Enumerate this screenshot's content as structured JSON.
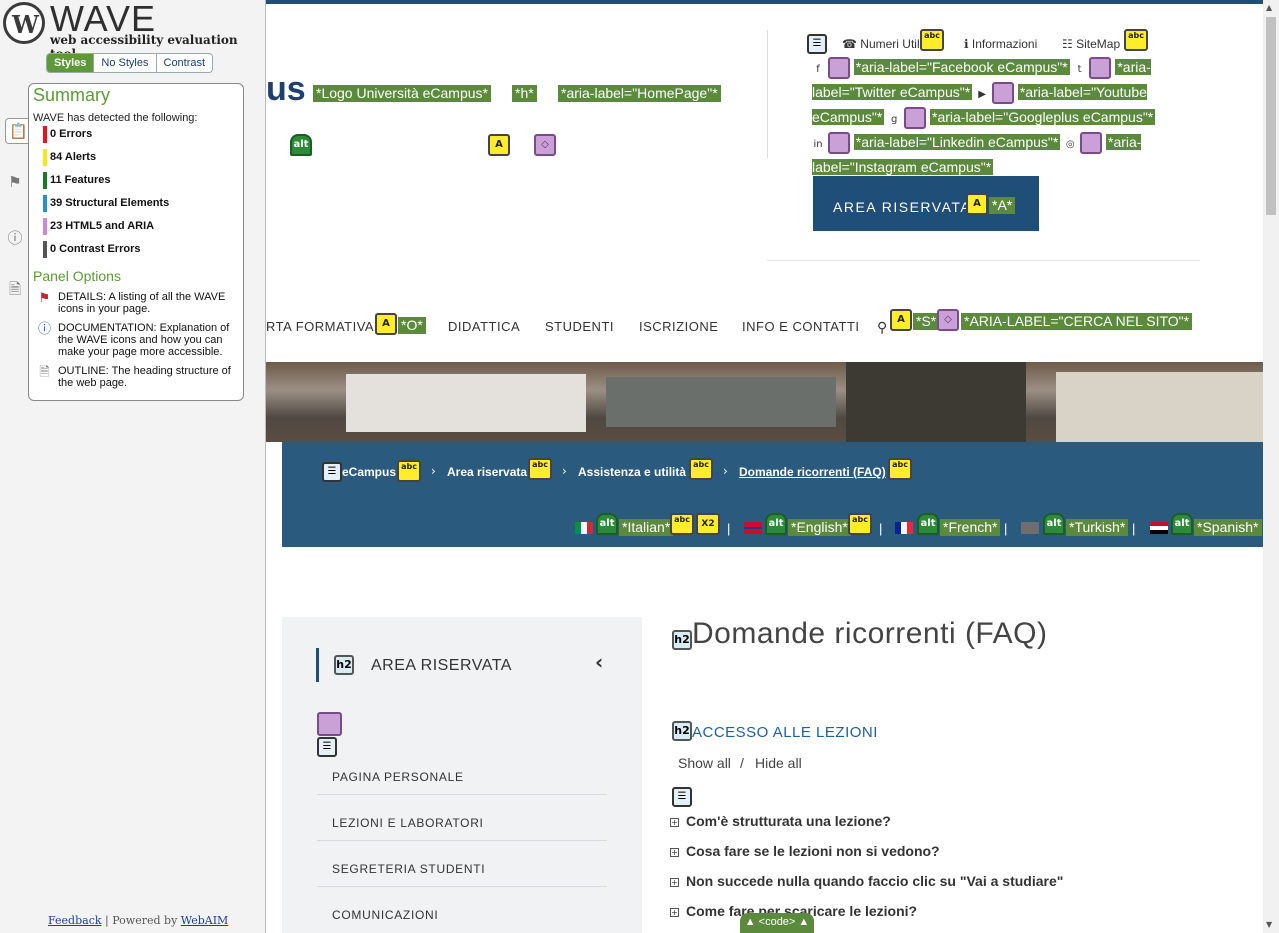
{
  "wave": {
    "title": "WAVE",
    "subtitle": "web accessibility evaluation tool",
    "tabs": [
      "Styles",
      "No Styles",
      "Contrast"
    ],
    "summary_title": "Summary",
    "detected": "WAVE has detected the following:",
    "counts": [
      {
        "label": "0 Errors",
        "color": "#e8131d"
      },
      {
        "label": "84 Alerts",
        "color": "#f8e81a"
      },
      {
        "label": "11 Features",
        "color": "#187a25"
      },
      {
        "label": "39 Structural Elements",
        "color": "#2a8ed6"
      },
      {
        "label": "23 HTML5 and ARIA",
        "color": "#c98ad6"
      },
      {
        "label": "0 Contrast Errors",
        "color": "#555555"
      }
    ],
    "panel_options": "Panel Options",
    "options": [
      {
        "icon": "flag-icon",
        "text": "DETAILS: A listing of all the WAVE icons in your page."
      },
      {
        "icon": "info-icon",
        "text": "DOCUMENTATION: Explanation of the WAVE icons and how you can make your page more accessible."
      },
      {
        "icon": "document-icon",
        "text": "OUTLINE: The heading structure of the web page."
      }
    ],
    "footer_feedback": "Feedback",
    "footer_sep": " | Powered by ",
    "footer_webaim": "WebAIM"
  },
  "header": {
    "logo_fragment": "us",
    "logo_label": "*Logo Università eCampus*",
    "h_label": "*h*",
    "home_label": "*aria-label=\"HomePage\"*",
    "util_numeri": "Numeri Utili",
    "util_info": "Informazioni",
    "util_sitemap": "SiteMap",
    "social": [
      "*aria-label=\"Facebook eCampus\"*",
      "*aria-label=\"Twitter eCampus\"*",
      "*aria-label=\"Youtube eCampus\"*",
      "*aria-label=\"Googleplus eCampus\"*",
      "*aria-label=\"Linkedin eCampus\"*",
      "*aria-label=\"Instagram eCampus\"*"
    ],
    "area_button": "AREA RISERVATA",
    "area_label": "*A*"
  },
  "nav": {
    "offerta": "RTA FORMATIVA",
    "offerta_label": "*O*",
    "items": [
      "DIDATTICA",
      "STUDENTI",
      "ISCRIZIONE",
      "INFO E CONTATTI"
    ],
    "search_label": "*S*",
    "search_aria": "*ARIA-LABEL=\"CERCA NEL SITO\"*"
  },
  "breadcrumb": [
    "eCampus",
    "Area riservata",
    "Assistenza e utilità",
    "Domande ricorrenti (FAQ)"
  ],
  "languages": [
    "*Italian*",
    "*English*",
    "*French*",
    "*Turkish*",
    "*Spanish*"
  ],
  "sidebar": {
    "title": "AREA RISERVATA",
    "items": [
      "PAGINA PERSONALE",
      "LEZIONI E LABORATORI",
      "SEGRETERIA STUDENTI",
      "COMUNICAZIONI"
    ]
  },
  "content": {
    "title": "Domande ricorrenti (FAQ)",
    "section": "ACCESSO ALLE LEZIONI",
    "show_all": "Show all",
    "sep": "/",
    "hide_all": "Hide all",
    "faqs": [
      "Com'è strutturata una lezione?",
      "Cosa fare se le lezioni non si vedono?",
      "Non succede nulla quando faccio clic su \"Vai a studiare\"",
      "Come fare per scaricare le lezioni?"
    ],
    "code_tab": "▲ <code> ▲"
  }
}
